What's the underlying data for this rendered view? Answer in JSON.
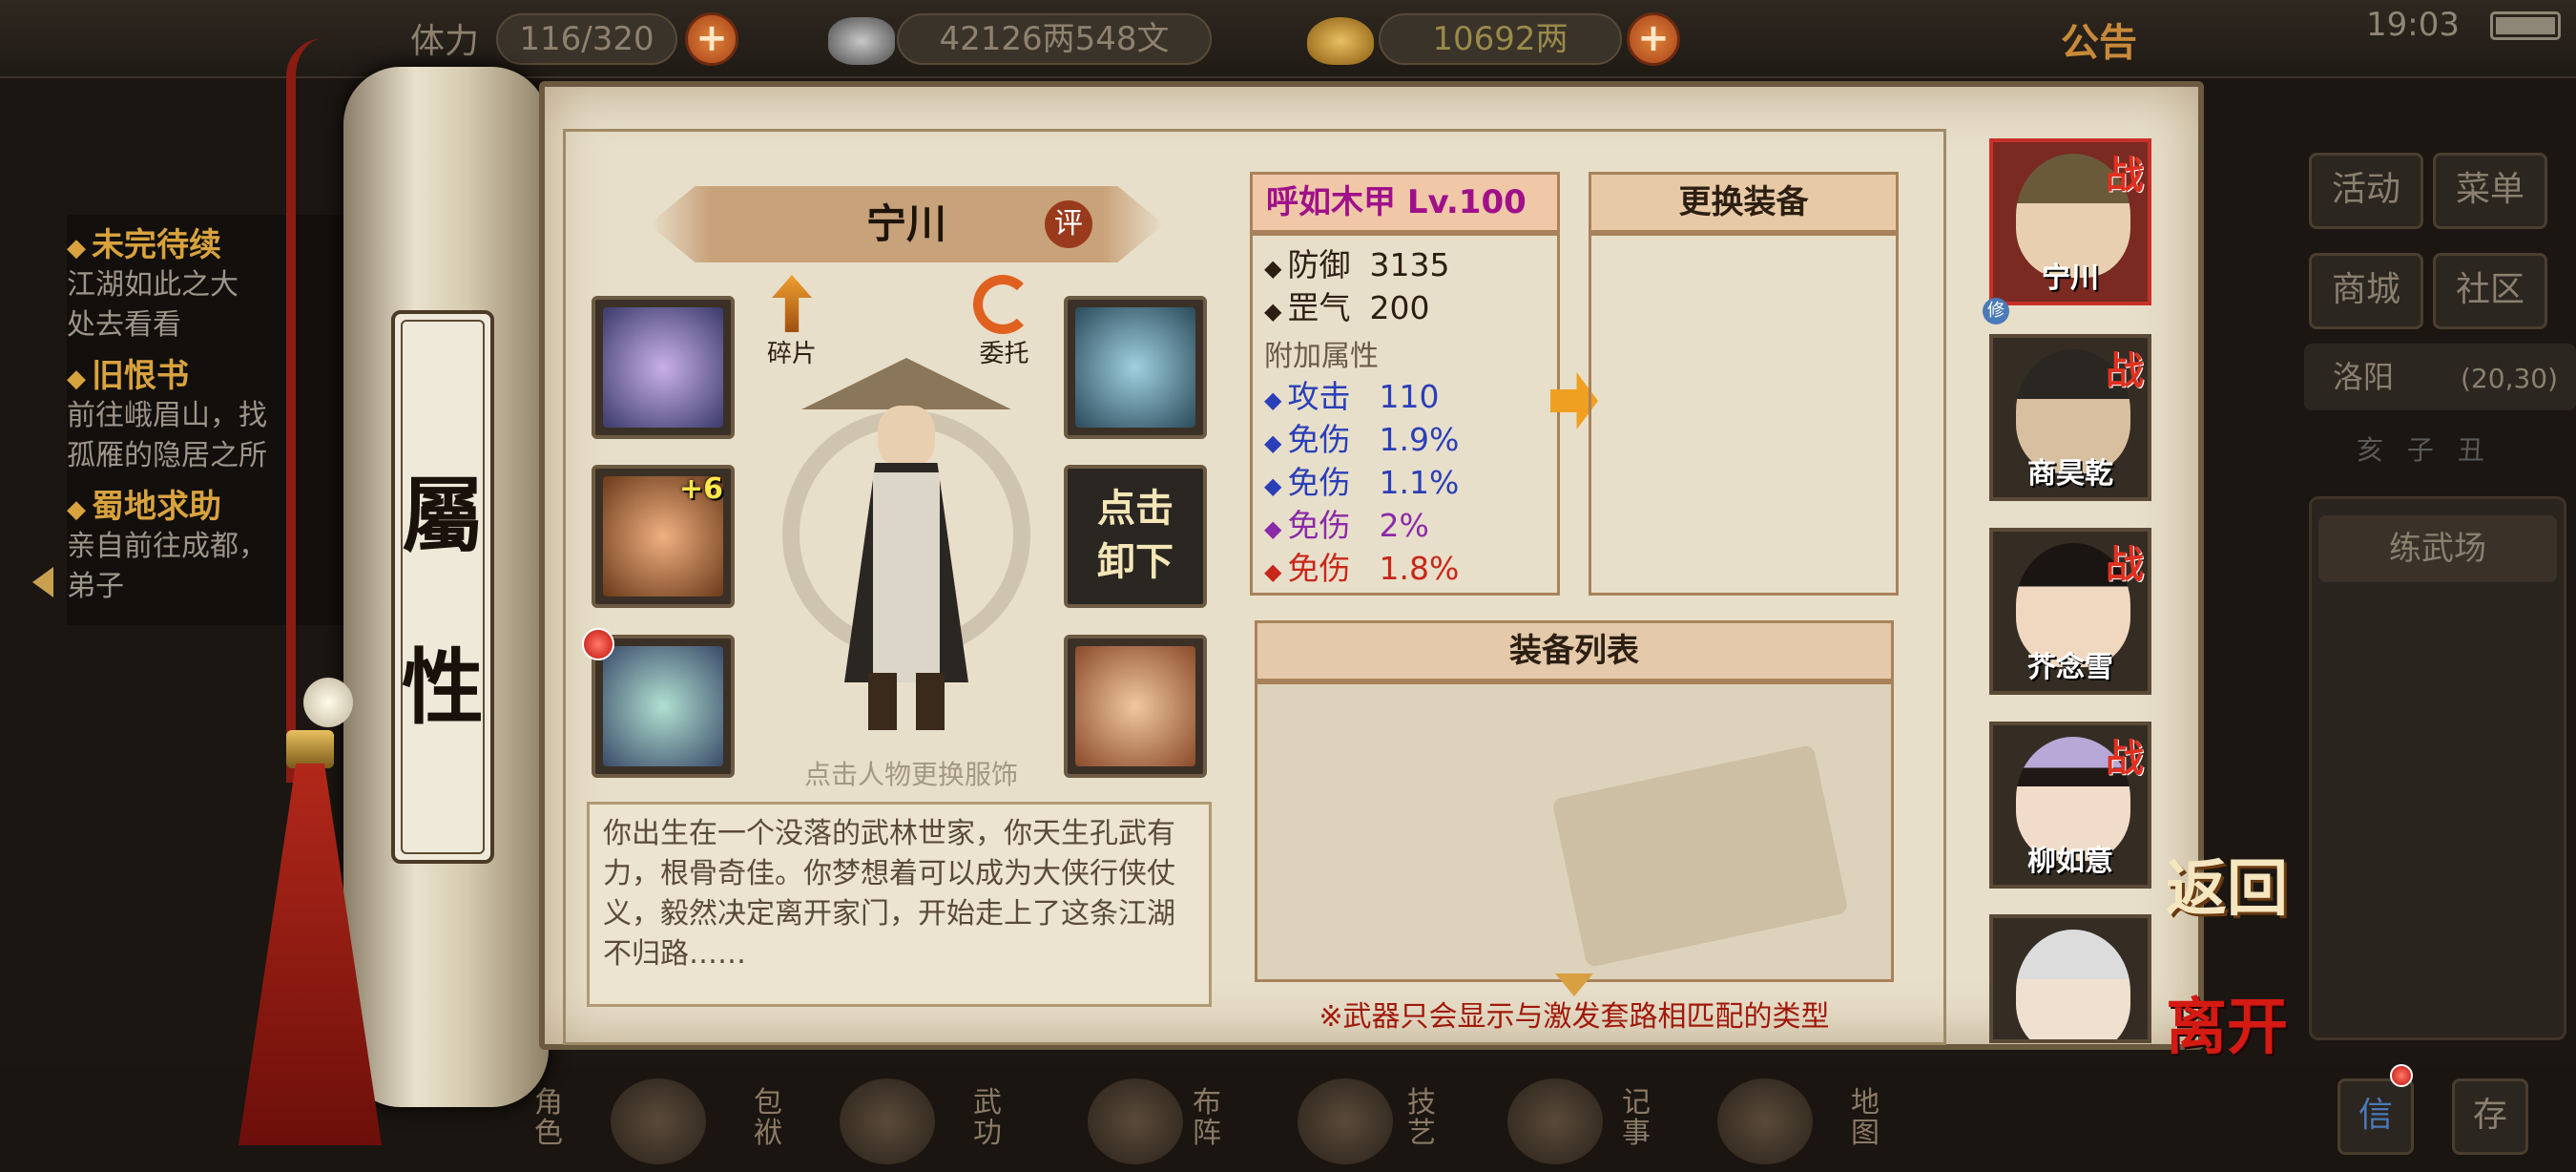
{
  "topbar": {
    "stamina_label": "体力",
    "stamina": "116/320",
    "money": "42126两548文",
    "gold": "10692两",
    "notice": "公告",
    "time": "19:03",
    "battery_percent": 100
  },
  "quests": [
    {
      "title": "未完待续",
      "lines": [
        "江湖如此之大",
        "处去看看"
      ]
    },
    {
      "title": "旧恨书",
      "lines": [
        "前往峨眉山，找",
        "孤雁的隐居之所"
      ]
    },
    {
      "title": "蜀地求助",
      "lines": [
        "亲自前往成都，",
        "弟子"
      ]
    }
  ],
  "scroll": {
    "char1": "屬",
    "char2": "性"
  },
  "character": {
    "name": "宁川",
    "rate": "评",
    "fragments": "碎片",
    "entrust": "委托",
    "unequip_line1": "点击",
    "unequip_line2": "卸下",
    "upgrade": "+6",
    "hint": "点击人物更换服饰",
    "description": "你出生在一个没落的武林世家，你天生孔武有力，根骨奇佳。你梦想着可以成为大侠行侠仗义，毅然决定离开家门，开始走上了这条江湖不归路……"
  },
  "item": {
    "name": "呼如木甲 Lv.100",
    "base": [
      {
        "label": "防御",
        "value": "3135"
      },
      {
        "label": "罡气",
        "value": "200"
      }
    ],
    "extra_label": "附加属性",
    "extra": [
      {
        "label": "攻击",
        "value": "110",
        "color": "#2a3fb8"
      },
      {
        "label": "免伤",
        "value": "1.9%",
        "color": "#2a3fb8"
      },
      {
        "label": "免伤",
        "value": "1.1%",
        "color": "#2a3fb8"
      },
      {
        "label": "免伤",
        "value": "2%",
        "color": "#8a2aa8"
      },
      {
        "label": "免伤",
        "value": "1.8%",
        "color": "#c8281a"
      }
    ]
  },
  "swap_header": "更换装备",
  "list_header": "装备列表",
  "note": "※武器只会显示与激发套路相匹配的类型",
  "party": [
    {
      "name": "宁川",
      "tag": "战"
    },
    {
      "name": "商昊乾",
      "tag": "战"
    },
    {
      "name": "芥念雪",
      "tag": "战"
    },
    {
      "name": "柳如意",
      "tag": "战"
    },
    {
      "name": "",
      "tag": ""
    }
  ],
  "party_badge": "修",
  "back": "返回",
  "leave": "离开",
  "right_menu": {
    "activity": "活动",
    "menu": "菜单",
    "shop": "商城",
    "community": "社区",
    "location": "洛阳",
    "coords": "(20,30)",
    "time_cycle": "亥 子 丑",
    "training": "练武场",
    "mail": "信",
    "save": "存"
  },
  "bottom_nav": [
    "角色",
    "包袱",
    "武功",
    "布阵",
    "技艺",
    "记事",
    "地图"
  ],
  "colors": {
    "accent_red": "#c8281a",
    "item_name": "#a0108a",
    "gold_text": "#d8a23e"
  }
}
